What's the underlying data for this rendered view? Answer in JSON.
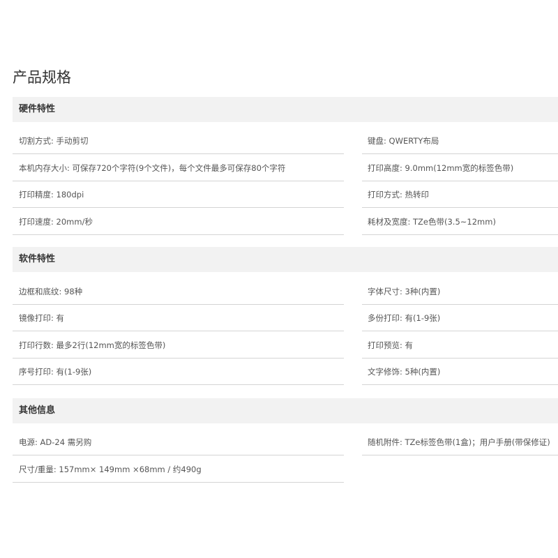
{
  "page_title": "产品规格",
  "sections": [
    {
      "title": "硬件特性",
      "left": [
        "切割方式: 手动剪切",
        "本机内存大小: 可保存720个字符(9个文件)，每个文件最多可保存80个字符",
        "打印精度: 180dpi",
        "打印速度: 20mm/秒"
      ],
      "right": [
        "键盘: QWERTY布局",
        "打印高度: 9.0mm(12mm宽的标签色带)",
        "打印方式: 热转印",
        "耗材及宽度: TZe色带(3.5~12mm)"
      ]
    },
    {
      "title": "软件特性",
      "left": [
        "边框和底纹: 98种",
        "镜像打印: 有",
        "打印行数: 最多2行(12mm宽的标签色带)",
        "序号打印: 有(1-9张)"
      ],
      "right": [
        "字体尺寸: 3种(内置)",
        "多份打印: 有(1-9张)",
        "打印预览: 有",
        "文字修饰: 5种(内置)"
      ]
    },
    {
      "title": "其他信息",
      "left": [
        "电源: AD-24 需另购",
        "尺寸/重量: 157mm× 149mm ×68mm / 约490g"
      ],
      "right": [
        "随机附件: TZe标签色带(1盒)；用户手册(带保修证)"
      ]
    }
  ]
}
